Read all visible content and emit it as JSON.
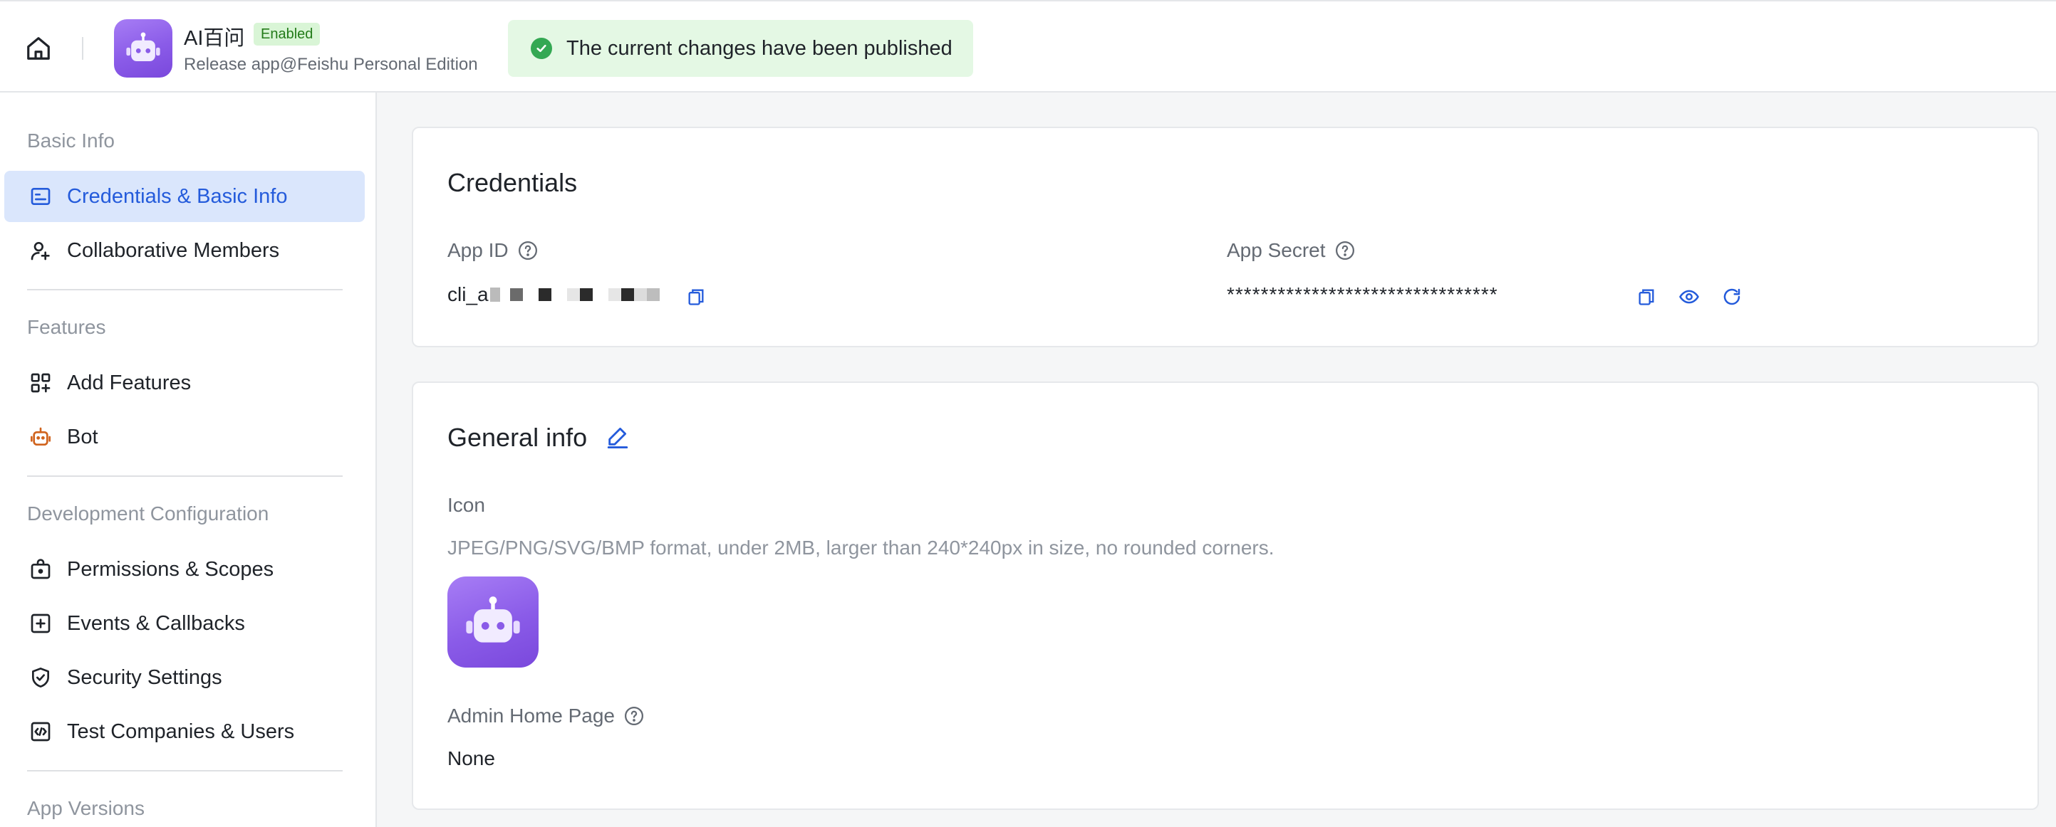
{
  "header": {
    "app_name": "AI百问",
    "status_badge": "Enabled",
    "subtitle": "Release app@Feishu Personal Edition",
    "toast_message": "The current changes have been published"
  },
  "sidebar": {
    "sections": [
      {
        "title": "Basic Info",
        "items": [
          {
            "label": "Credentials & Basic Info",
            "icon": "id-card-icon",
            "active": true
          },
          {
            "label": "Collaborative Members",
            "icon": "add-user-icon",
            "active": false
          }
        ]
      },
      {
        "title": "Features",
        "items": [
          {
            "label": "Add Features",
            "icon": "grid-plus-icon",
            "active": false
          },
          {
            "label": "Bot",
            "icon": "robot-icon",
            "active": false
          }
        ]
      },
      {
        "title": "Development Configuration",
        "items": [
          {
            "label": "Permissions & Scopes",
            "icon": "lock-bag-icon",
            "active": false
          },
          {
            "label": "Events & Callbacks",
            "icon": "plus-square-icon",
            "active": false
          },
          {
            "label": "Security Settings",
            "icon": "shield-icon",
            "active": false
          },
          {
            "label": "Test Companies & Users",
            "icon": "code-square-icon",
            "active": false
          }
        ]
      },
      {
        "title": "App Versions",
        "items": []
      }
    ]
  },
  "credentials": {
    "title": "Credentials",
    "app_id_label": "App ID",
    "app_id_value": "cli_a",
    "app_secret_label": "App Secret",
    "app_secret_value": "********************************"
  },
  "general_info": {
    "title": "General info",
    "icon_label": "Icon",
    "icon_hint": "JPEG/PNG/SVG/BMP format, under 2MB, larger than 240*240px in size, no rounded corners.",
    "admin_home_label": "Admin Home Page",
    "admin_home_value": "None"
  },
  "colors": {
    "accent": "#245bdb",
    "active_bg": "#dae6fc",
    "success_bg": "#e4f8e4",
    "success_icon": "#34a853",
    "app_icon": "#8a5be8"
  }
}
